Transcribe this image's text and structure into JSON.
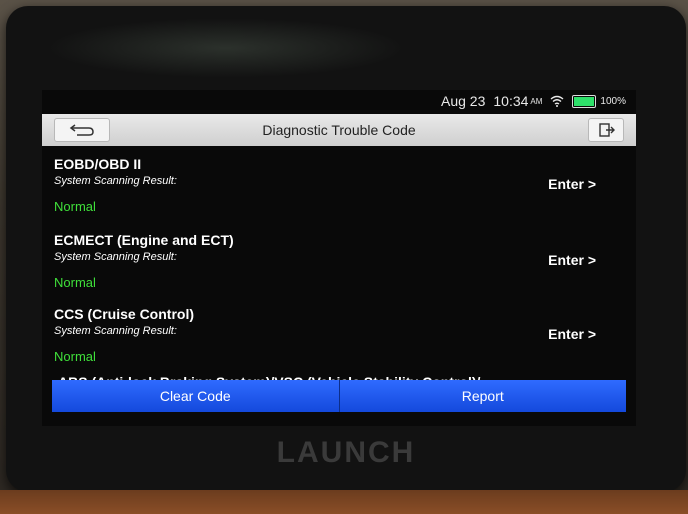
{
  "status_bar": {
    "date": "Aug 23",
    "time": "10:34",
    "ampm": "AM",
    "battery": "100%"
  },
  "header": {
    "title": "Diagnostic Trouble Code"
  },
  "systems": [
    {
      "name": "EOBD/OBD II",
      "sub": "System Scanning Result:",
      "status": "Normal",
      "action": "Enter >"
    },
    {
      "name": "ECMECT (Engine and ECT)",
      "sub": "System Scanning Result:",
      "status": "Normal",
      "action": "Enter >"
    },
    {
      "name": "CCS (Cruise Control)",
      "sub": "System Scanning Result:",
      "status": "Normal",
      "action": "Enter >"
    }
  ],
  "partial_item": "ABS (Anti-lock Braking System)/VSC (Vehicle Stability Control)/",
  "footer": {
    "clear_label": "Clear Code",
    "report_label": "Report"
  },
  "brand": "LAUNCH",
  "colors": {
    "status_ok": "#3fe03a",
    "button_blue": "#1a58f2",
    "battery_green": "#2ee06a"
  },
  "icons": {
    "back": "back-arrow-icon",
    "exit": "exit-icon",
    "wifi": "wifi-icon",
    "battery": "battery-icon"
  }
}
